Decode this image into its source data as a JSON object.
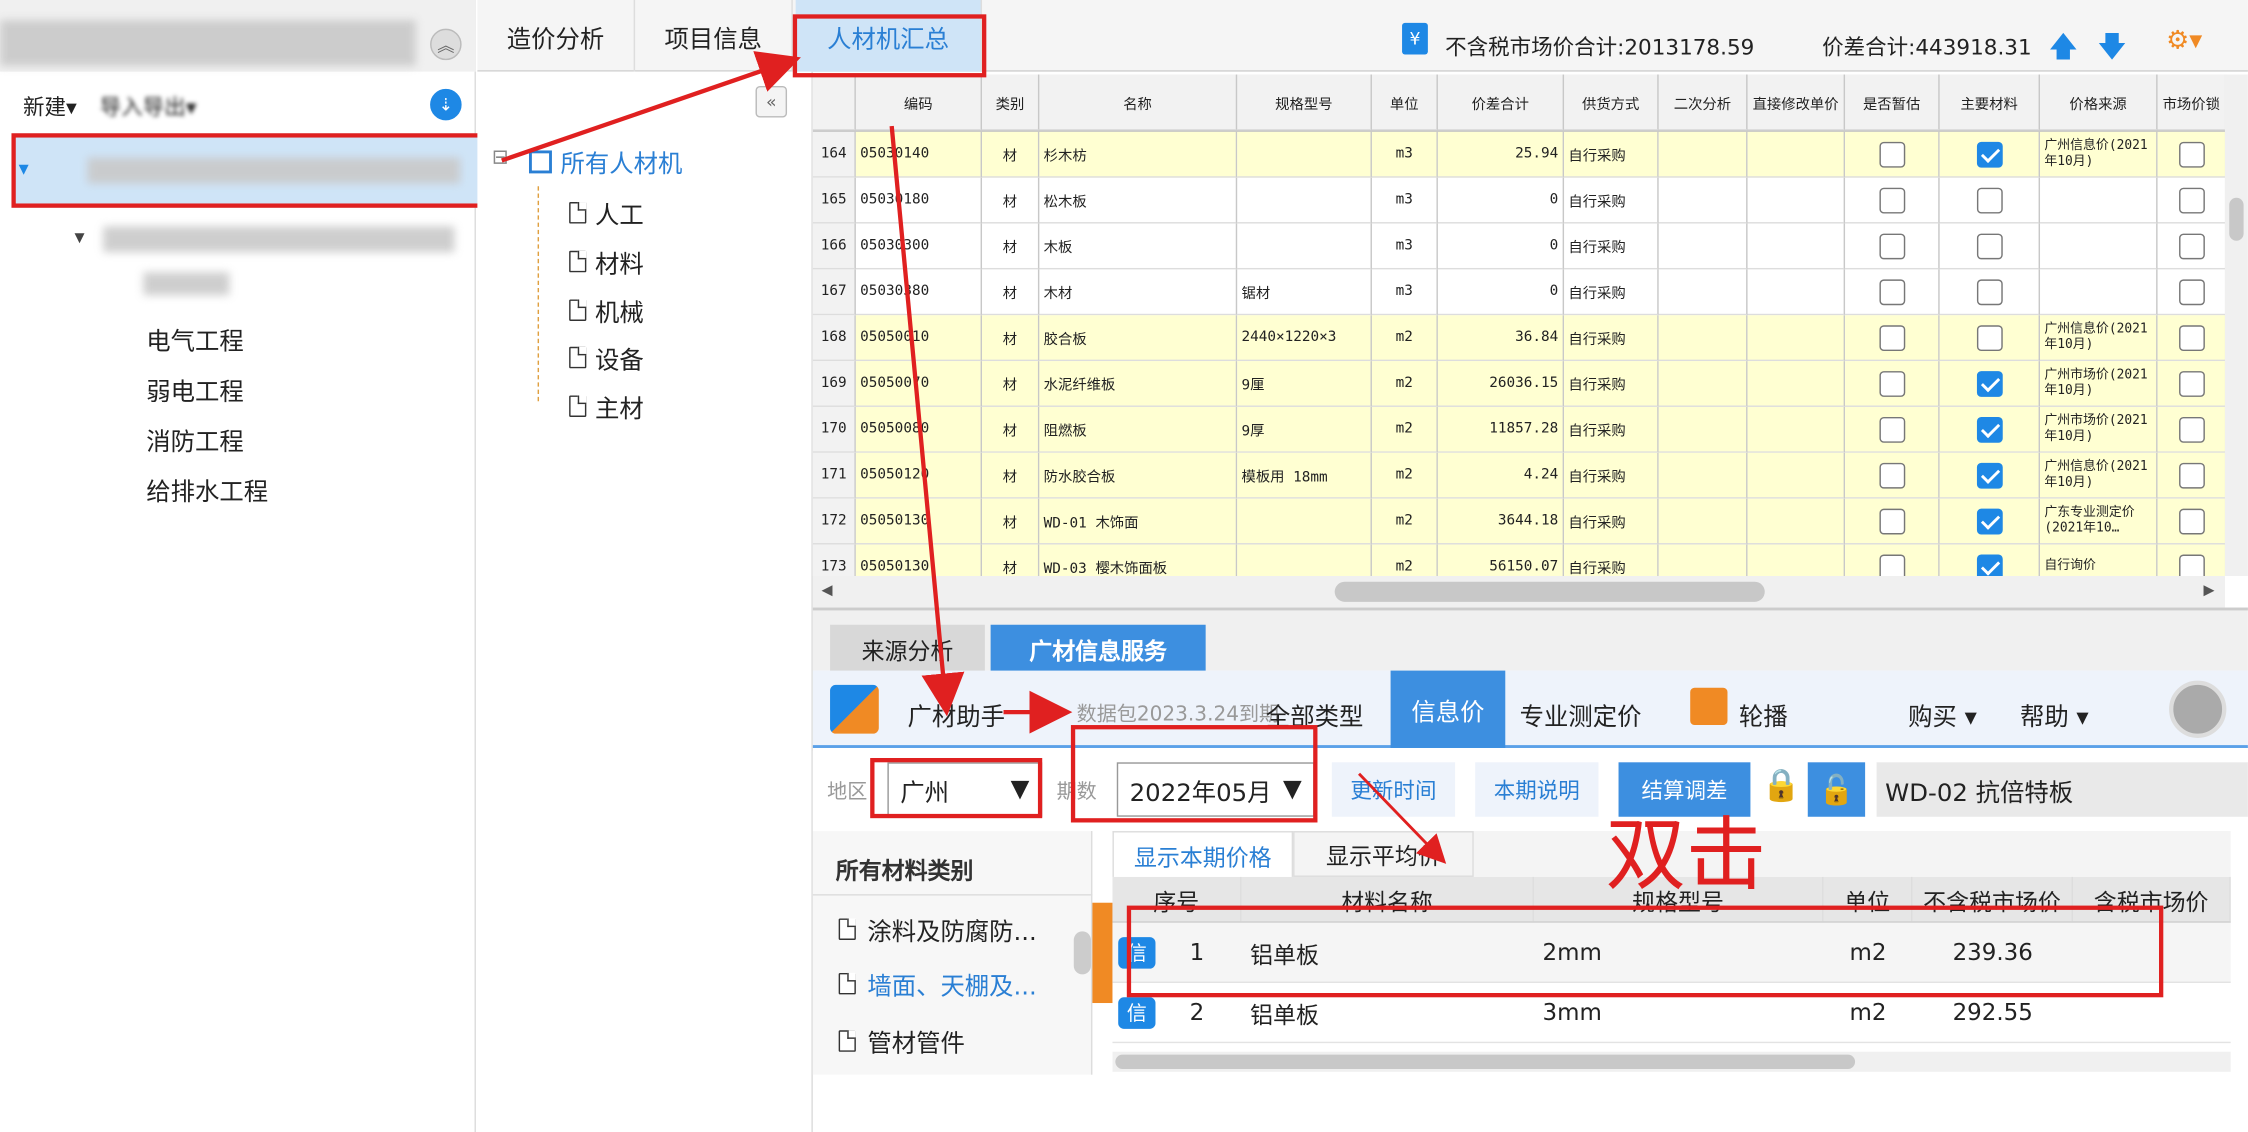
{
  "left": {
    "new_label": "新建",
    "import_export_label": "导入导出",
    "tree": [
      "电气工程",
      "弱电工程",
      "消防工程",
      "给排水工程"
    ]
  },
  "tabs": [
    "造价分析",
    "项目信息",
    "人材机汇总"
  ],
  "summary": {
    "market_total": "不含税市场价合计:2013178.59",
    "diff_total": "价差合计:443918.31"
  },
  "nav": {
    "root": "所有人材机",
    "children": [
      "人工",
      "材料",
      "机械",
      "设备",
      "主材"
    ]
  },
  "grid": {
    "headers": [
      "编码",
      "类别",
      "名称",
      "规格型号",
      "单位",
      "价差合计",
      "供货方式",
      "二次分析",
      "直接修改单价",
      "是否暂估",
      "主要材料",
      "价格来源",
      "市场价锁"
    ],
    "rows": [
      {
        "idx": "164",
        "code": "05030140",
        "type": "材",
        "name": "杉木枋",
        "spec": "",
        "unit": "m3",
        "diff": "25.94",
        "supply": "自行采购",
        "est": false,
        "main": true,
        "source": "广州信息价(2021年10月)",
        "y": true
      },
      {
        "idx": "165",
        "code": "05030180",
        "type": "材",
        "name": "松木板",
        "spec": "",
        "unit": "m3",
        "diff": "0",
        "supply": "自行采购",
        "est": false,
        "main": false,
        "source": "",
        "y": false
      },
      {
        "idx": "166",
        "code": "05030300",
        "type": "材",
        "name": "木板",
        "spec": "",
        "unit": "m3",
        "diff": "0",
        "supply": "自行采购",
        "est": false,
        "main": false,
        "source": "",
        "y": false
      },
      {
        "idx": "167",
        "code": "05030380",
        "type": "材",
        "name": "木材",
        "spec": "锯材",
        "unit": "m3",
        "diff": "0",
        "supply": "自行采购",
        "est": false,
        "main": false,
        "source": "",
        "y": false
      },
      {
        "idx": "168",
        "code": "05050010",
        "type": "材",
        "name": "胶合板",
        "spec": "2440×1220×3",
        "unit": "m2",
        "diff": "36.84",
        "supply": "自行采购",
        "est": false,
        "main": false,
        "source": "广州信息价(2021年10月)",
        "y": true
      },
      {
        "idx": "169",
        "code": "05050070",
        "type": "材",
        "name": "水泥纤维板",
        "spec": "9厘",
        "unit": "m2",
        "diff": "26036.15",
        "supply": "自行采购",
        "est": false,
        "main": true,
        "source": "广州市场价(2021年10月)",
        "y": true
      },
      {
        "idx": "170",
        "code": "05050080",
        "type": "材",
        "name": "阻燃板",
        "spec": "9厚",
        "unit": "m2",
        "diff": "11857.28",
        "supply": "自行采购",
        "est": false,
        "main": true,
        "source": "广州市场价(2021年10月)",
        "y": true
      },
      {
        "idx": "171",
        "code": "05050120",
        "type": "材",
        "name": "防水胶合板",
        "spec": "模板用 18mm",
        "unit": "m2",
        "diff": "4.24",
        "supply": "自行采购",
        "est": false,
        "main": true,
        "source": "广州信息价(2021年10月)",
        "y": true
      },
      {
        "idx": "172",
        "code": "05050130",
        "type": "材",
        "name": "WD-01 木饰面",
        "spec": "",
        "unit": "m2",
        "diff": "3644.18",
        "supply": "自行采购",
        "est": false,
        "main": true,
        "source": "广东专业测定价(2021年10…",
        "y": true
      },
      {
        "idx": "173",
        "code": "05050130",
        "type": "材",
        "name": "WD-03 樱木饰面板",
        "spec": "",
        "unit": "m2",
        "diff": "56150.07",
        "supply": "自行采购",
        "est": false,
        "main": true,
        "source": "自行询价",
        "y": true
      }
    ]
  },
  "bottom_tabs": [
    "来源分析",
    "广材信息服务"
  ],
  "gc": {
    "title": "广材助手",
    "package": "数据包2023.3.24到期",
    "all_types": "全部类型",
    "info_price": "信息价",
    "pro_price": "专业测定价",
    "carousel": "轮播",
    "buy": "购买",
    "help": "帮助"
  },
  "filter": {
    "region_label": "地区",
    "region": "广州",
    "period_label": "期数",
    "period": "2022年05月",
    "update_time": "更新时间",
    "period_note": "本期说明",
    "settle": "结算调差",
    "search_value": "WD-02 抗倍特板"
  },
  "categories": {
    "header": "所有材料类别",
    "items": [
      "涂料及防腐防...",
      "墙面、天棚及...",
      "管材管件"
    ]
  },
  "price": {
    "subtabs": [
      "显示本期价格",
      "显示平均价"
    ],
    "headers": [
      "序号",
      "材料名称",
      "规格型号",
      "单位",
      "不含税市场价",
      "含税市场价"
    ],
    "badge": "信",
    "rows": [
      {
        "no": "1",
        "name": "铝单板",
        "spec": "2mm",
        "unit": "m2",
        "price": "239.36",
        "tax_price": ""
      },
      {
        "no": "2",
        "name": "铝单板",
        "spec": "3mm",
        "unit": "m2",
        "price": "292.55",
        "tax_price": ""
      }
    ]
  },
  "annotation": {
    "double_click": "双击"
  },
  "colors": {
    "accent": "#2a7fd4",
    "highlight": "#e02020",
    "row_yellow": "#ffffd2"
  }
}
